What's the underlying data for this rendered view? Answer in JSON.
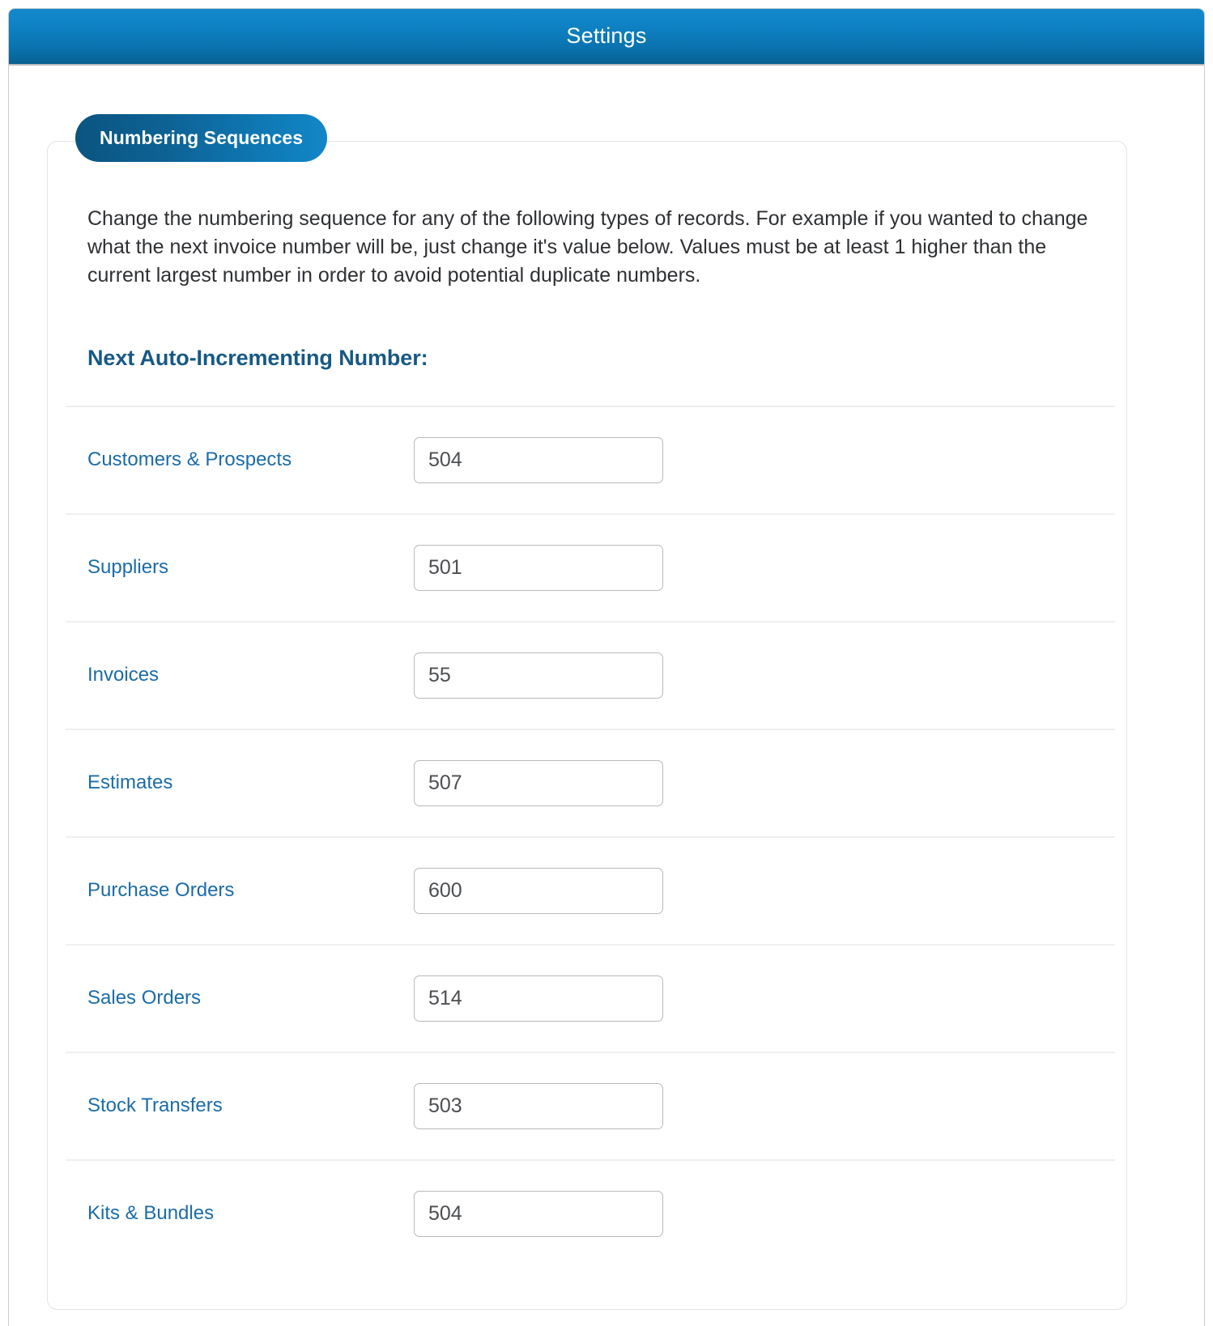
{
  "window": {
    "title": "Settings"
  },
  "card": {
    "badge_label": "Numbering Sequences",
    "intro_text": "Change the numbering sequence for any of the following types of records. For example if you wanted to change what the next invoice number will be, just change it's value below. Values must be at least 1 higher than the current largest number in order to avoid potential duplicate numbers.",
    "section_heading": "Next Auto-Incrementing Number:",
    "rows": [
      {
        "label": "Customers & Prospects",
        "value": "504"
      },
      {
        "label": "Suppliers",
        "value": "501"
      },
      {
        "label": "Invoices",
        "value": "55"
      },
      {
        "label": "Estimates",
        "value": "507"
      },
      {
        "label": "Purchase Orders",
        "value": "600"
      },
      {
        "label": "Sales Orders",
        "value": "514"
      },
      {
        "label": "Stock Transfers",
        "value": "503"
      },
      {
        "label": "Kits & Bundles",
        "value": "504"
      }
    ]
  },
  "colors": {
    "titlebar_top": "#1389cb",
    "titlebar_bottom": "#06608f",
    "badge_left": "#0b5480",
    "badge_right": "#1287c7",
    "label_blue": "#1b6ca8",
    "heading_blue": "#175984",
    "body_text": "#2e3033",
    "input_border": "#b8babc",
    "divider": "#eef0f1"
  }
}
